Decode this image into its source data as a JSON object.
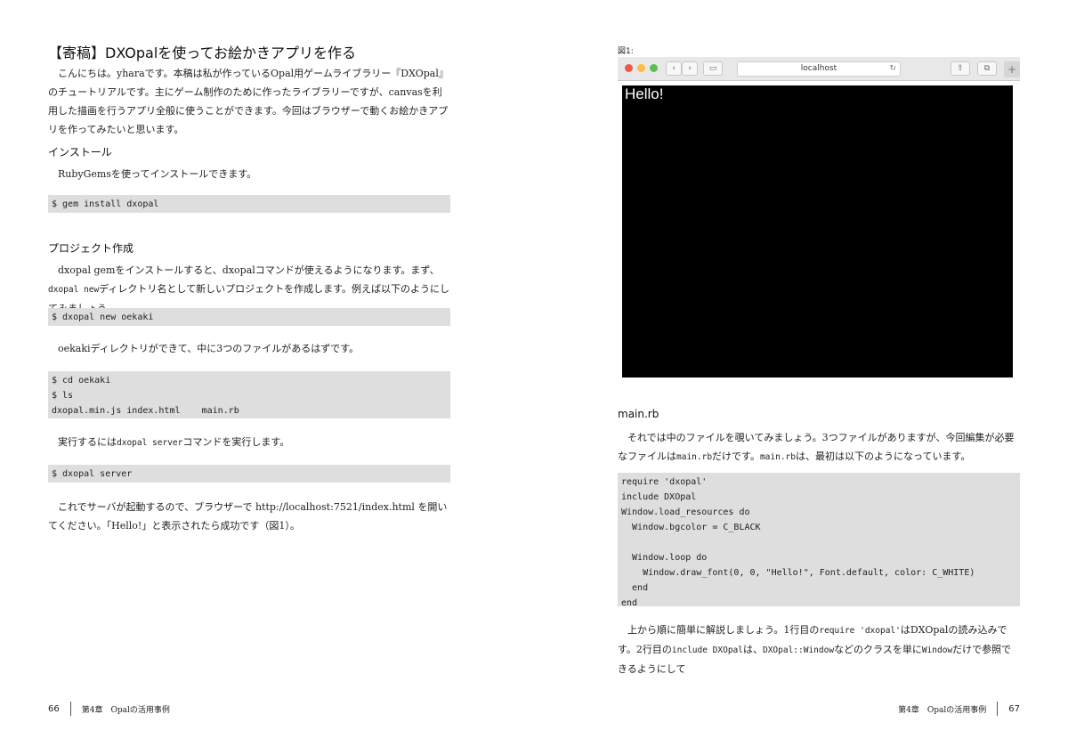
{
  "left": {
    "title": "【寄稿】DXOpalを使ってお絵かきアプリを作る",
    "intro": "こんにちは。yharaです。本稿は私が作っているOpal用ゲームライブラリー『DXOpal』のチュートリアルです。主にゲーム制作のために作ったライブラリーですが、canvasを利用した描画を行うアプリ全般に使うことができます。今回はブラウザーで動くお絵かきアプリを作ってみたいと思います。",
    "install_heading": "インストール",
    "install_text": "RubyGemsを使ってインストールできます。",
    "code1": "$ gem install dxopal",
    "project_heading": "プロジェクト作成",
    "project_text_a": "dxopal gemをインストールすると、dxopalコマンドが使えるようになります。まず、",
    "project_code_a": "dxopal new",
    "project_text_b": "ディレクトリ名として新しいプロジェクトを作成します。例えば以下のようにしてみましょう。",
    "code2": "$ dxopal new oekaki",
    "oekaki_text": "oekakiディレクトリができて、中に3つのファイルがあるはずです。",
    "code3_lines": [
      "$ cd oekaki",
      "$ ls",
      "dxopal.min.js index.html    main.rb"
    ],
    "run_text_a": "実行するには",
    "run_code": "dxopal server",
    "run_text_b": "コマンドを実行します。",
    "code4": "$ dxopal server",
    "server_text": "これでサーバが起動するので、ブラウザーで http://localhost:7521/index.html を開いてください。「Hello!」と表示されたら成功です（図1）。",
    "page_number": "66",
    "chapter": "第4章　Opalの活用事例"
  },
  "right": {
    "figure_label": "図1:",
    "browser": {
      "address": "localhost",
      "back_icon": "chevron-left",
      "forward_icon": "chevron-right",
      "canvas_text": "Hello!"
    },
    "mainrb_heading": "main.rb",
    "mainrb_text_a": "それでは中のファイルを覗いてみましょう。3つファイルがありますが、今回編集が必要なファイルは",
    "mainrb_code_a": "main.rb",
    "mainrb_text_b": "だけです。",
    "mainrb_code_b": "main.rb",
    "mainrb_text_c": "は、最初は以下のようになっています。",
    "code_lines": [
      "require 'dxopal'",
      "include DXOpal",
      "Window.load_resources do",
      "  Window.bgcolor = C_BLACK",
      "",
      "  Window.loop do",
      "    Window.draw_font(0, 0, \"Hello!\", Font.default, color: C_WHITE)",
      "  end",
      "end"
    ],
    "explain_text_a": "上から順に簡単に解説しましょう。1行目の",
    "explain_code_a": "require 'dxopal'",
    "explain_text_b": "はDXOpalの読み込みです。2行目の",
    "explain_code_b": "include DXOpal",
    "explain_text_c": "は、",
    "explain_code_c": "DXOpal::Window",
    "explain_text_d": "などのクラスを単に",
    "explain_code_d": "Window",
    "explain_text_e": "だけで参照できるようにして",
    "page_number": "67",
    "chapter": "第4章　Opalの活用事例"
  }
}
